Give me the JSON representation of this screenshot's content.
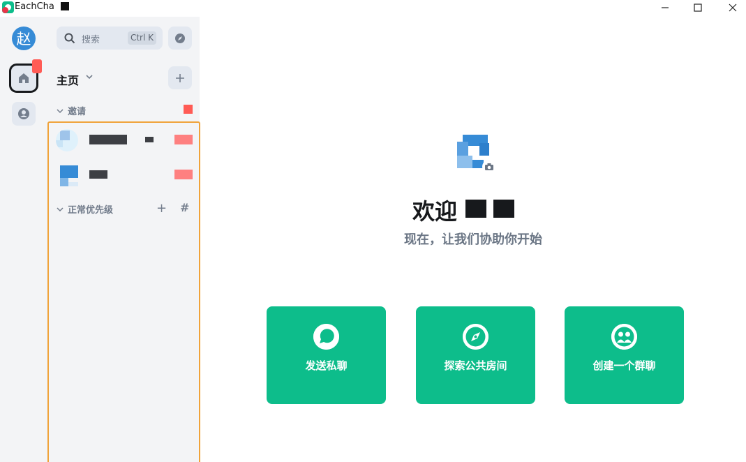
{
  "window": {
    "title": "EachChat",
    "minimize": "—",
    "maximize": "☐",
    "close": "✕"
  },
  "rail": {
    "user_avatar_letter": "赵"
  },
  "sidebar": {
    "search_placeholder": "搜索",
    "search_shortcut": "Ctrl K",
    "home_title": "主页",
    "sections": [
      {
        "label": "邀请"
      },
      {
        "label": "正常优先级"
      }
    ]
  },
  "main": {
    "welcome_title": "欢迎",
    "welcome_subtitle": "现在，让我们协助你开始",
    "actions": [
      {
        "label": "发送私聊",
        "icon": "chat-bubble-icon"
      },
      {
        "label": "探索公共房间",
        "icon": "compass-icon"
      },
      {
        "label": "创建一个群聊",
        "icon": "group-icon"
      }
    ]
  },
  "colors": {
    "accent": "#0dbd8b",
    "unread": "#ff5b55",
    "selection_outline": "#f0a33a"
  }
}
